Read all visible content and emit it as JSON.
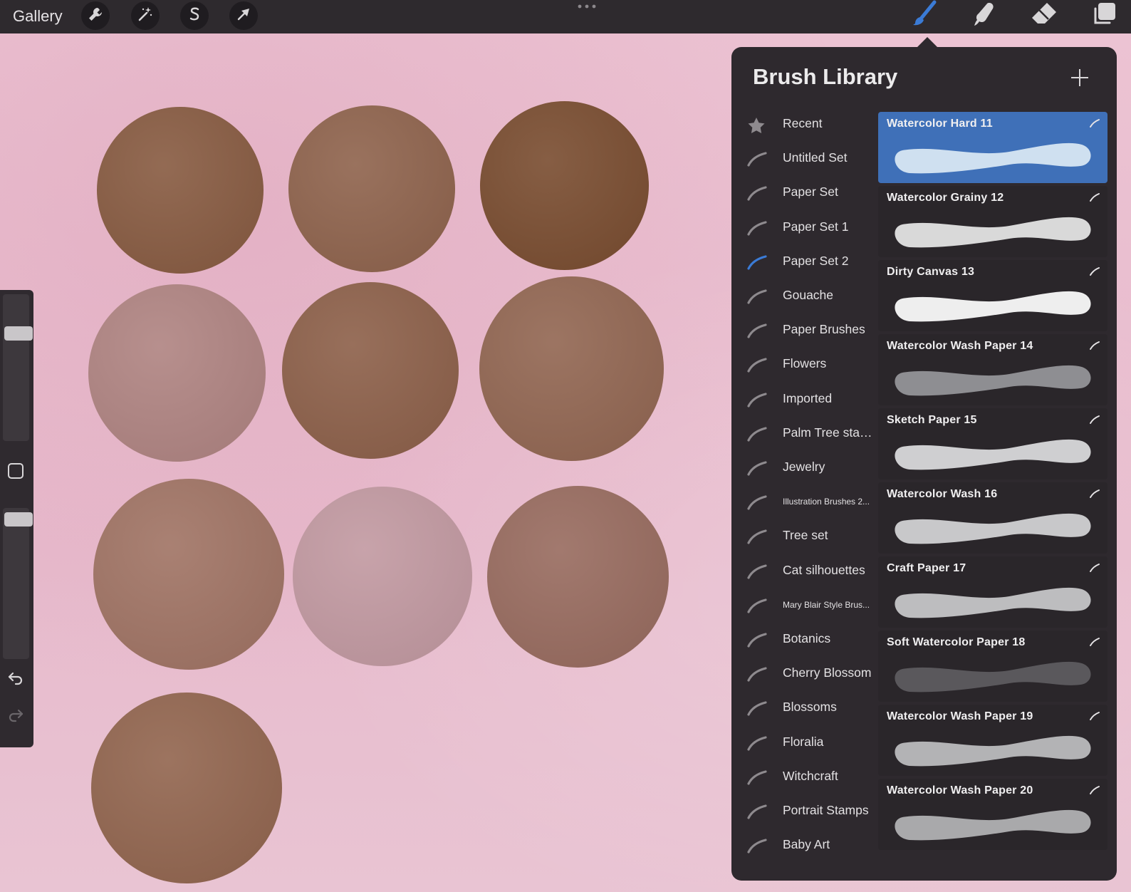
{
  "toolbar": {
    "gallery_label": "Gallery",
    "left_tools": [
      {
        "name": "wrench-icon"
      },
      {
        "name": "magic-wand-icon"
      },
      {
        "name": "selection-s-icon"
      },
      {
        "name": "arrow-transform-icon"
      }
    ],
    "right_tools": [
      {
        "name": "brush-icon",
        "active": true
      },
      {
        "name": "smudge-icon",
        "active": false
      },
      {
        "name": "eraser-icon",
        "active": false
      },
      {
        "name": "layers-icon",
        "active": false
      }
    ],
    "accent_color": "#3b7bd6"
  },
  "brush_library": {
    "title": "Brush Library",
    "add_icon": "plus-icon",
    "sets": [
      {
        "label": "Recent",
        "icon": "star-icon"
      },
      {
        "label": "Untitled Set",
        "icon": "brush-stroke-icon"
      },
      {
        "label": "Paper Set",
        "icon": "brush-stroke-icon"
      },
      {
        "label": "Paper Set 1",
        "icon": "brush-stroke-icon"
      },
      {
        "label": "Paper Set 2",
        "icon": "brush-stroke-icon",
        "active": true
      },
      {
        "label": "Gouache",
        "icon": "brush-stroke-icon"
      },
      {
        "label": "Paper Brushes",
        "icon": "brush-stroke-icon"
      },
      {
        "label": "Flowers",
        "icon": "brush-stroke-icon"
      },
      {
        "label": "Imported",
        "icon": "brush-stroke-icon"
      },
      {
        "label": "Palm Tree stamps",
        "icon": "brush-stroke-icon"
      },
      {
        "label": "Jewelry",
        "icon": "brush-stroke-icon"
      },
      {
        "label": "Illustration Brushes 2...",
        "icon": "brush-stroke-icon",
        "small": true
      },
      {
        "label": "Tree set",
        "icon": "brush-stroke-icon"
      },
      {
        "label": "Cat silhouettes",
        "icon": "brush-stroke-icon"
      },
      {
        "label": "Mary Blair Style Brus...",
        "icon": "brush-stroke-icon",
        "small": true
      },
      {
        "label": "Botanics",
        "icon": "brush-stroke-icon"
      },
      {
        "label": "Cherry Blossom",
        "icon": "brush-stroke-icon"
      },
      {
        "label": "Blossoms",
        "icon": "brush-stroke-icon"
      },
      {
        "label": "Floralia",
        "icon": "brush-stroke-icon"
      },
      {
        "label": "Witchcraft",
        "icon": "brush-stroke-icon"
      },
      {
        "label": "Portrait Stamps",
        "icon": "brush-stroke-icon"
      },
      {
        "label": "Baby Art",
        "icon": "brush-stroke-icon"
      }
    ],
    "brushes": [
      {
        "name": "Watercolor Hard 11",
        "selected": true,
        "stroke_color": "#cfe0f0"
      },
      {
        "name": "Watercolor Grainy 12",
        "stroke_color": "#d9d9d9"
      },
      {
        "name": "Dirty Canvas 13",
        "stroke_color": "#eeeeee"
      },
      {
        "name": "Watercolor Wash Paper 14",
        "stroke_color": "#8e8e92"
      },
      {
        "name": "Sketch Paper 15",
        "stroke_color": "#cfcfd1"
      },
      {
        "name": "Watercolor Wash 16",
        "stroke_color": "#c8c8ca"
      },
      {
        "name": "Craft Paper 17",
        "stroke_color": "#bdbdbf"
      },
      {
        "name": "Soft Watercolor Paper 18",
        "stroke_color": "#5a585c"
      },
      {
        "name": "Watercolor Wash Paper 19",
        "stroke_color": "#b3b3b5"
      },
      {
        "name": "Watercolor Wash Paper 20",
        "stroke_color": "#a9a9ab"
      }
    ]
  },
  "canvas": {
    "background_color": "#e9bfd0",
    "swatch_colors": [
      "#8a5e45",
      "#916650",
      "#7c5034",
      "#b18684",
      "#8f634d",
      "#946955",
      "#a27667",
      "#c39ba3",
      "#9a6e62",
      "#946852"
    ]
  },
  "sidebar": {
    "size_slider_value": 0.24,
    "opacity_slider_value": 0.03,
    "modify_icon": "square-icon",
    "undo_icon": "undo-icon",
    "redo_icon": "redo-icon"
  }
}
